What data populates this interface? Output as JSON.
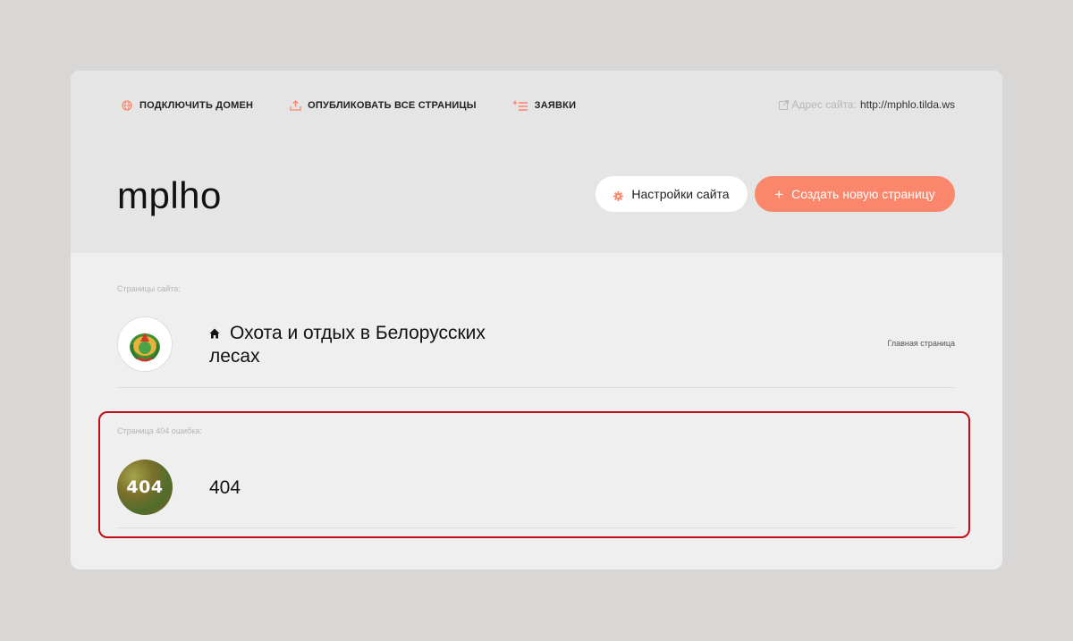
{
  "topnav": {
    "items": [
      {
        "label": "ПОДКЛЮЧИТЬ ДОМЕН",
        "icon": "globe-icon"
      },
      {
        "label": "ОПУБЛИКОВАТЬ ВСЕ СТРАНИЦЫ",
        "icon": "upload-icon"
      },
      {
        "label": "ЗАЯВКИ",
        "icon": "list-plus-icon"
      }
    ],
    "address_label": "Адрес сайта:",
    "address_url": "http://mphlo.tilda.ws"
  },
  "site": {
    "title": "mplho",
    "settings_label": "Настройки сайта",
    "create_label": "Создать новую страницу"
  },
  "pages_section": {
    "label": "Страницы сайта:",
    "pages": [
      {
        "title": "Охота и отдых в Белорусских лесах",
        "tag": "Главная страница",
        "icon": "home-icon"
      }
    ]
  },
  "error_section": {
    "label": "Страница 404 ошибка:",
    "page_title": "404",
    "thumb_text": "404"
  },
  "colors": {
    "accent": "#fa876b",
    "highlight_border": "#c10d16",
    "page_bg": "#d9d6d6",
    "panel_bg": "#efefef",
    "header_bg": "#e5e5e5"
  }
}
